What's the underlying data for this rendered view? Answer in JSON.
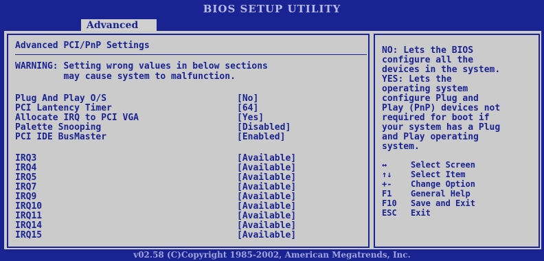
{
  "header": {
    "title": "BIOS SETUP UTILITY",
    "active_tab": "Advanced"
  },
  "main": {
    "heading": "Advanced PCI/PnP Settings",
    "warning_line1": "WARNING: Setting wrong values in below sections",
    "warning_line2": "         may cause system to malfunction.",
    "settings": [
      {
        "label": "Plug And Play O/S",
        "value": "[No]"
      },
      {
        "label": "PCI Lantency Timer",
        "value": "[64]"
      },
      {
        "label": "Allocate IRQ to PCI VGA",
        "value": "[Yes]"
      },
      {
        "label": "Palette Snooping",
        "value": "[Disabled]"
      },
      {
        "label": "PCI IDE BusMaster",
        "value": "[Enabled]"
      }
    ],
    "irqs": [
      {
        "label": "IRQ3",
        "value": "[Available]"
      },
      {
        "label": "IRQ4",
        "value": "[Available]"
      },
      {
        "label": "IRQ5",
        "value": "[Available]"
      },
      {
        "label": "IRQ7",
        "value": "[Available]"
      },
      {
        "label": "IRQ9",
        "value": "[Available]"
      },
      {
        "label": "IRQ10",
        "value": "[Available]"
      },
      {
        "label": "IRQ11",
        "value": "[Available]"
      },
      {
        "label": "IRQ14",
        "value": "[Available]"
      },
      {
        "label": "IRQ15",
        "value": "[Available]"
      }
    ]
  },
  "help": {
    "lines": [
      "NO: Lets the BIOS",
      "configure all the",
      "devices in the system.",
      "YES: Lets the",
      "operating system",
      "configure Plug and",
      "Play (PnP) devices not",
      "required for boot if",
      "your system has a Plug",
      "and Play operating",
      "system."
    ],
    "keys": [
      {
        "key": "↔",
        "action": "Select Screen",
        "icon": "left-right-arrow-icon"
      },
      {
        "key": "↑↓",
        "action": "Select Item",
        "icon": "up-down-arrow-icon"
      },
      {
        "key": "+-",
        "action": "Change Option",
        "icon": "plus-minus-icon"
      },
      {
        "key": "F1",
        "action": "General Help",
        "icon": "f1-key"
      },
      {
        "key": "F10",
        "action": "Save and Exit",
        "icon": "f10-key"
      },
      {
        "key": "ESC",
        "action": "Exit",
        "icon": "esc-key"
      }
    ]
  },
  "footer": {
    "copyright": "v02.58 (C)Copyright 1985-2002, American Megatrends, Inc."
  },
  "colors": {
    "background": "#1a2392",
    "panel": "#cbcbcb",
    "text": "#1a2392"
  }
}
